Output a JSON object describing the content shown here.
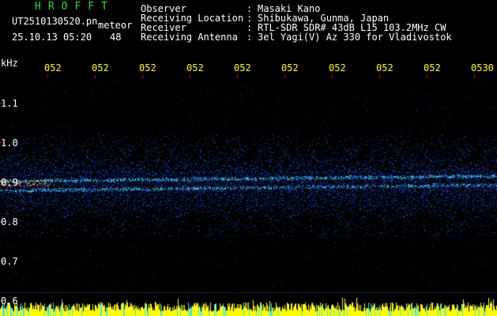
{
  "header": {
    "title": "HROFFT",
    "filename": "UT2510130520.pn",
    "mode": "meteor",
    "datetime": "25.10.13 05:20",
    "count": "48",
    "info": [
      {
        "label": "Observer",
        "sep": ":",
        "value": "Masaki Kano"
      },
      {
        "label": "Receiving Location",
        "sep": ":",
        "value": "Shibukawa, Gunma, Japan"
      },
      {
        "label": "Receiver",
        "sep": ":",
        "value": "RTL-SDR SDR# 43dB L15 103.2MHz CW"
      },
      {
        "label": "Receiving Antenna",
        "sep": ":",
        "value": "3el Yagi(V) Az 330 for Vladivostok"
      }
    ]
  },
  "axes": {
    "unit": "kHz",
    "time_labels": [
      "052",
      "052",
      "052",
      "052",
      "052",
      "052",
      "052",
      "052",
      "052",
      "0530"
    ],
    "freq_labels": [
      "1.1",
      "1.0",
      "0.9",
      "0.8",
      "0.7",
      "0.6"
    ]
  },
  "colors": {
    "title": "#20e040",
    "text": "#ffffff",
    "time_labels": "#ffff00",
    "tick": "#ff0000",
    "signal": "#1060ff",
    "bottom_band": "#ffff00"
  }
}
